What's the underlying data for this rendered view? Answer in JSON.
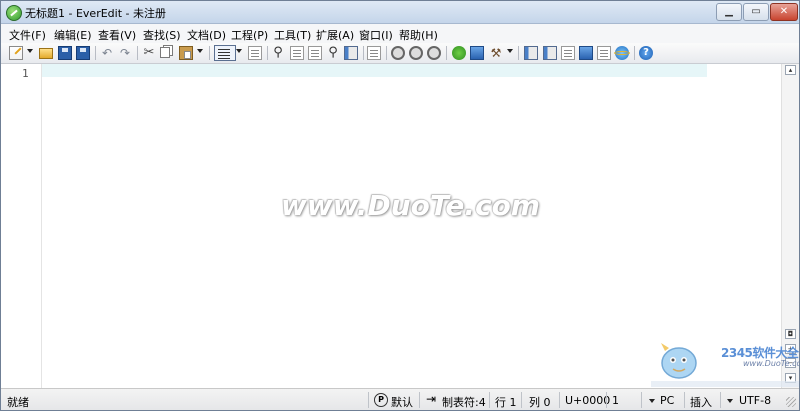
{
  "window": {
    "title": "无标题1 - EverEdit - 未注册",
    "min": "0",
    "max": "1",
    "close": "r"
  },
  "menu": [
    "文件(F)",
    "编辑(E)",
    "查看(V)",
    "查找(S)",
    "文档(D)",
    "工程(P)",
    "工具(T)",
    "扩展(A)",
    "窗口(I)",
    "帮助(H)"
  ],
  "toolbar": {
    "icons": [
      "new-file-icon",
      "open-folder-icon",
      "save-icon",
      "save-all-icon",
      "undo-icon",
      "redo-icon",
      "cut-icon",
      "copy-icon",
      "paste-icon",
      "word-wrap-icon",
      "document-icon",
      "find-icon",
      "replace-icon",
      "spell-check-icon",
      "find-in-files-icon",
      "outline-icon",
      "bookmark-icon",
      "macro-record-icon",
      "macro-play-icon",
      "macro-save-icon",
      "plugin-icon",
      "window-icon",
      "build-icon",
      "sidebar-icon",
      "panel-icon",
      "file-tree-icon",
      "output-icon",
      "ruler-icon",
      "browser-icon",
      "help-icon"
    ],
    "undo_glyph": "↶",
    "redo_glyph": "↷",
    "cut_glyph": "✂",
    "find_glyph": "⚲",
    "hammer_glyph": "⚒",
    "help_glyph": "?"
  },
  "editor": {
    "line_numbers": [
      "1"
    ],
    "current_line_color": "#e6f6f8"
  },
  "watermark": {
    "text": "www.DuoTe.com"
  },
  "scrollbar": {
    "top": "▴",
    "split": "◘",
    "zoom_in": "+",
    "zoom_out": "−",
    "bottom": "▾"
  },
  "status": {
    "ready": "就绪",
    "p_icon": "P",
    "default": "默认",
    "tab_icon": "⇥",
    "tab": "制表符:4",
    "line": "行 1",
    "col": "列 0",
    "unicode": "U+0000",
    "count": "1",
    "eol": "PC",
    "insert": "插入",
    "encoding": "UTF-8"
  },
  "logo": {
    "brand": "2345软件大全",
    "url": "www.DuoTe.com"
  }
}
